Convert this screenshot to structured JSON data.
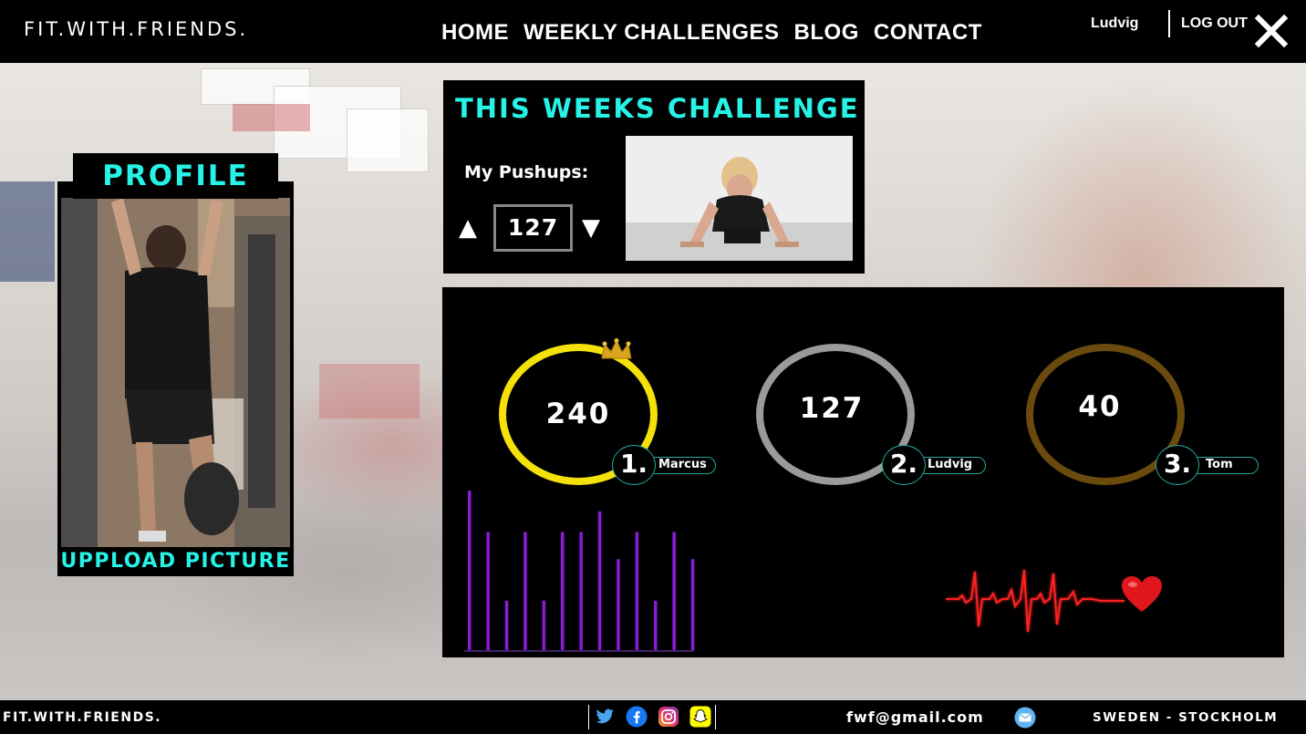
{
  "header": {
    "logo": "FIT.WITH.FRIENDS.",
    "nav": [
      "HOME",
      "WEEKLY CHALLENGES",
      "BLOG",
      "CONTACT"
    ],
    "user_name": "Ludvig",
    "logout": "LOG OUT"
  },
  "profile": {
    "title": "PROFILE",
    "upload": "UPPLOAD PICTURE"
  },
  "challenge": {
    "title": "THIS WEEKS CHALLENGE",
    "label": "My Pushups:",
    "value": "127",
    "up_arrow": "▲",
    "down_arrow": "▼"
  },
  "leaderboard": [
    {
      "rank": "1.",
      "name": "Marcus",
      "score": "240",
      "color": "#f5e10a"
    },
    {
      "rank": "2.",
      "name": "Ludvig",
      "score": "127",
      "color": "#9a9a9a"
    },
    {
      "rank": "3.",
      "name": "Tom",
      "score": "40",
      "color": "#6b4a0e"
    }
  ],
  "accent_color": "#27f2e6",
  "bars_chart": {
    "color": "#8a1bd6",
    "values": [
      1.0,
      0.74,
      0.31,
      0.74,
      0.31,
      0.74,
      0.74,
      0.87,
      0.57,
      0.74,
      0.31,
      0.74,
      0.57
    ]
  },
  "icons": [
    "crown-icon",
    "heartbeat-icon",
    "heart-icon",
    "twitter-icon",
    "facebook-icon",
    "instagram-icon",
    "snapchat-icon",
    "mail-icon",
    "close-icon"
  ],
  "footer": {
    "logo": "FIT.WITH.FRIENDS.",
    "email": "fwf@gmail.com",
    "location": "SWEDEN - STOCKHOLM"
  }
}
